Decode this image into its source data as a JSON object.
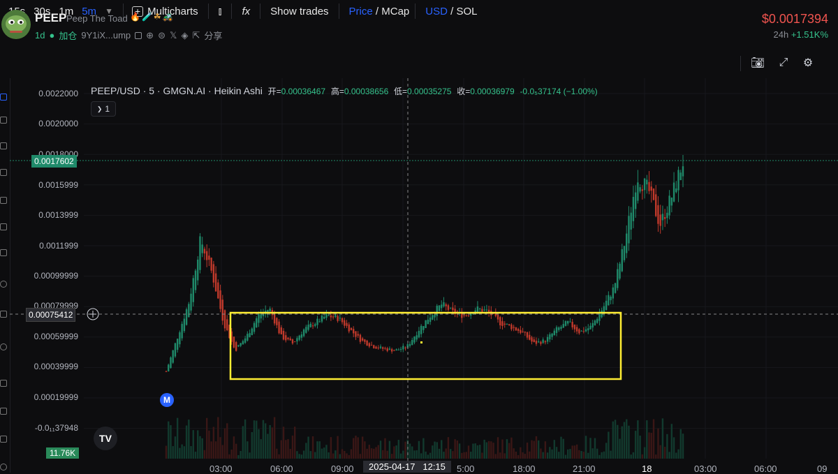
{
  "header": {
    "symbol": "PEEP",
    "name": "Peep The Toad",
    "badges": "🔥🧪☘🚜",
    "age": "1d",
    "add_position": "加仓",
    "address": "9Y1iX...ump",
    "share": "分享",
    "price": "$0.0017394",
    "change_label": "24h",
    "change_value": "+1.51K%"
  },
  "toolbar": {
    "intervals": [
      "15s",
      "30s",
      "1m",
      "5m"
    ],
    "active_interval": "5m",
    "multicharts": "Multicharts",
    "fx": "fx",
    "show_trades": "Show trades",
    "price": "Price",
    "mcap": "MCap",
    "usd": "USD",
    "sol": "SOL",
    "slash": "/"
  },
  "legend": {
    "title": "PEEP/USD · 5 · GMGN.AI · Heikin Ashi",
    "open_label": "开=",
    "open": "0.00036467",
    "high_label": "高=",
    "high": "0.00038656",
    "low_label": "低=",
    "low": "0.00035275",
    "close_label": "收=",
    "close": "0.00036979",
    "change": "-0.0₅37174 (−1.00%)",
    "collapse_count": "1"
  },
  "price_axis": {
    "labels": [
      "0.0022000",
      "0.0020000",
      "0.0018000",
      "0.0015999",
      "0.0013999",
      "0.0011999",
      "0.00099999",
      "0.00079999",
      "0.00059999",
      "0.00039999",
      "0.00019999",
      "-0.0₁₁37948"
    ],
    "current_price_tag": "0.0017602",
    "crosshair_price_tag": "0.00075412",
    "volume_tag": "11.76K"
  },
  "time_axis": {
    "labels": [
      "03:00",
      "06:00",
      "09:00",
      "5:00",
      "18:00",
      "21:00",
      "18",
      "03:00",
      "06:00",
      "09"
    ],
    "crosshair_date": "2025-04-17",
    "crosshair_time": "12:15"
  },
  "markers": {
    "m": "M",
    "tv": "TV"
  },
  "colors": {
    "up": "#1f8a6a",
    "down": "#c0392b",
    "box": "#ffee33",
    "accent": "#2962ff",
    "price_red": "#f0544f"
  },
  "chart_data": {
    "type": "candlestick",
    "style": "Heikin Ashi",
    "pair": "PEEP/USD",
    "interval": "5",
    "source": "GMGN.AI",
    "ylim": [
      -0.0002,
      0.0022
    ],
    "highlight_box": {
      "time_range": [
        "04:00",
        "23:20"
      ],
      "price_range": [
        0.00032,
        0.00076
      ]
    },
    "time_labels": [
      "03:00",
      "06:00",
      "09:00",
      "5:00",
      "18:00",
      "21:00",
      "18",
      "03:00",
      "06:00",
      "09"
    ],
    "x_ticks": [
      "03:00",
      "03:30",
      "04:00",
      "04:30",
      "05:00",
      "05:30",
      "06:00",
      "06:30",
      "07:00",
      "07:30",
      "08:00",
      "08:30",
      "09:00",
      "09:30",
      "10:00",
      "10:30",
      "11:00",
      "11:30",
      "12:00",
      "12:30",
      "13:00",
      "13:30",
      "14:00",
      "14:30",
      "15:00",
      "15:30",
      "16:00",
      "16:30",
      "17:00",
      "17:30",
      "18:00",
      "18:30",
      "19:00",
      "19:30",
      "20:00",
      "20:30",
      "21:00",
      "21:30",
      "22:00",
      "22:30",
      "23:00",
      "23:30",
      "00:00",
      "00:30",
      "01:00",
      "01:30"
    ],
    "close": [
      0.0002,
      0.00045,
      0.0007,
      0.00115,
      0.0009,
      0.00055,
      0.00035,
      0.00045,
      0.0006,
      0.00065,
      0.00045,
      0.0004,
      0.0005,
      0.00055,
      0.0006,
      0.00058,
      0.0005,
      0.00042,
      0.00038,
      0.00036,
      0.00035,
      0.00038,
      0.0005,
      0.0006,
      0.00068,
      0.00062,
      0.0006,
      0.00065,
      0.00063,
      0.00055,
      0.00052,
      0.00048,
      0.0004,
      0.00042,
      0.0005,
      0.00055,
      0.00048,
      0.00052,
      0.00065,
      0.0008,
      0.00115,
      0.0016,
      0.0015,
      0.00125,
      0.00145,
      0.0017
    ]
  }
}
